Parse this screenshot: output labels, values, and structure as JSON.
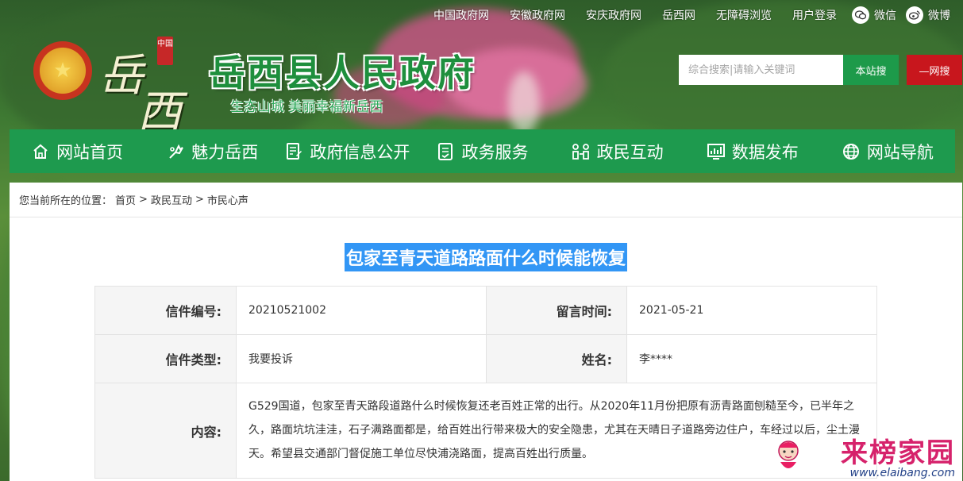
{
  "top_links": [
    "中国政府网",
    "安徽政府网",
    "安庆政府网",
    "岳西网",
    "无障碍浏览",
    "用户登录"
  ],
  "social": [
    {
      "label": "微信",
      "icon": "wechat-icon"
    },
    {
      "label": "微博",
      "icon": "weibo-icon"
    }
  ],
  "header": {
    "seal_text": "中国",
    "calligraphy": [
      "岳",
      "西"
    ],
    "title": "岳西县人民政府",
    "slogan": "生态山城 美丽幸福新岳西"
  },
  "search": {
    "placeholder": "综合搜索|请输入关键词",
    "site_button": "本站搜",
    "web_button": "—网搜"
  },
  "nav": [
    {
      "label": "网站首页",
      "icon": "home-icon"
    },
    {
      "label": "魅力岳西",
      "icon": "flower-icon"
    },
    {
      "label": "政府信息公开",
      "icon": "document-icon"
    },
    {
      "label": "政务服务",
      "icon": "service-icon"
    },
    {
      "label": "政民互动",
      "icon": "interaction-icon"
    },
    {
      "label": "数据发布",
      "icon": "chart-icon"
    },
    {
      "label": "网站导航",
      "icon": "globe-icon"
    }
  ],
  "breadcrumb": {
    "prefix": "您当前所在的位置：",
    "items": [
      "首页",
      "政民互动",
      "市民心声"
    ],
    "separator": ">"
  },
  "article": {
    "title": "包家至青天道路路面什么时候能恢复",
    "fields": {
      "letter_no_label": "信件编号:",
      "letter_no": "20210521002",
      "time_label": "留言时间:",
      "time": "2021-05-21",
      "type_label": "信件类型:",
      "type": "我要投诉",
      "name_label": "姓名:",
      "name": "李****",
      "content_label": "内容:",
      "content": "G529国道，包家至青天路段道路什么时候恢复还老百姓正常的出行。从2020年11月份把原有沥青路面刨糙至今，已半年之久，路面坑坑洼洼，石子满路面都是，给百姓出行带来极大的安全隐患，尤其在天晴日子道路旁边住户，车经过以后，尘土漫天。希望县交通部门督促施工单位尽快浦浇路面，提高百姓出行质量。"
    }
  },
  "watermark": {
    "main": "来榜家园",
    "url": "www.elaibang.com"
  }
}
